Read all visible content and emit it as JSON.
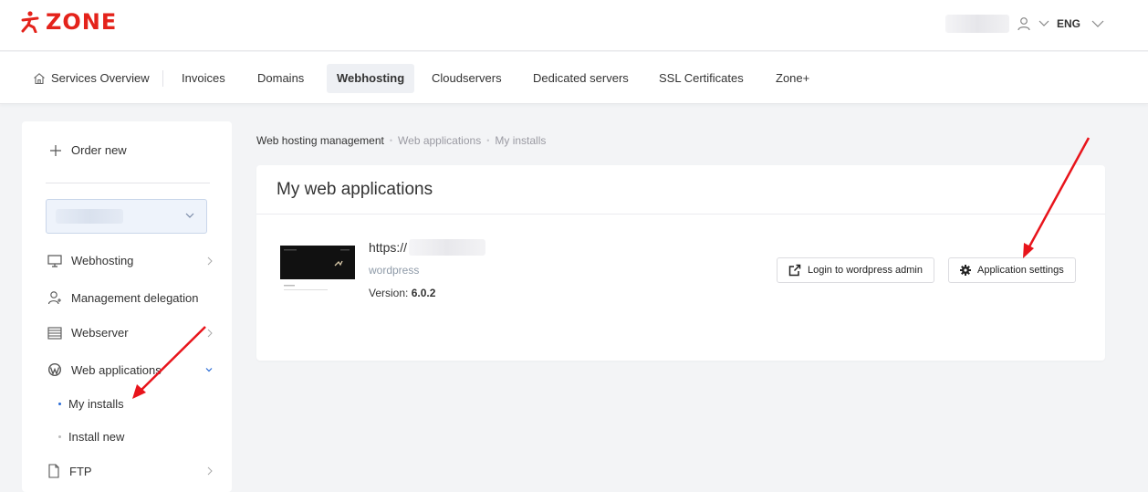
{
  "header": {
    "logo_text": "ZONE",
    "language": "ENG",
    "brand_color": "#e4231b"
  },
  "nav": {
    "items": [
      {
        "label": "Services Overview",
        "icon": "home-icon"
      },
      {
        "label": "Invoices"
      },
      {
        "label": "Domains"
      },
      {
        "label": "Webhosting",
        "active": true
      },
      {
        "label": "Cloudservers"
      },
      {
        "label": "Dedicated servers"
      },
      {
        "label": "SSL Certificates"
      },
      {
        "label": "Zone+"
      }
    ]
  },
  "sidebar": {
    "order_new": "Order new",
    "items": [
      {
        "label": "Webhosting",
        "icon": "monitor-icon"
      },
      {
        "label": "Management delegation",
        "icon": "user-add-icon"
      },
      {
        "label": "Webserver",
        "icon": "server-icon"
      },
      {
        "label": "Web applications",
        "icon": "wordpress-icon",
        "expanded": true
      },
      {
        "label": "FTP",
        "icon": "file-icon"
      }
    ],
    "sub_items": [
      {
        "label": "My installs",
        "active": true
      },
      {
        "label": "Install new"
      }
    ]
  },
  "breadcrumb": {
    "root": "Web hosting management",
    "level1": "Web applications",
    "level2": "My installs"
  },
  "main": {
    "title": "My web applications",
    "app": {
      "url_prefix": "https://",
      "name": "wordpress",
      "version_label": "Version:",
      "version": "6.0.2"
    },
    "buttons": {
      "login": "Login to wordpress admin",
      "settings": "Application settings"
    }
  },
  "colors": {
    "annotation_arrow": "#e8141b",
    "active_dot": "#2a6cd6",
    "muted_text": "#8e9aa8"
  }
}
